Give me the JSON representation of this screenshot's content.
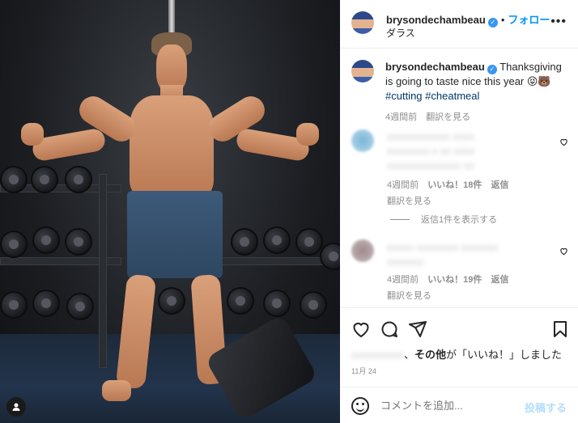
{
  "post": {
    "username": "brysondechambeau",
    "separator": "•",
    "follow_label": "フォロー",
    "more_label": "•••",
    "location": "ダラス"
  },
  "caption": {
    "username": "brysondechambeau",
    "text": "Thanksgiving is going to taste nice this year 😝🐻",
    "hashtag1": "#cutting",
    "hashtag2": "#cheatmeal",
    "time": "4週間前",
    "translate": "翻訳を見る"
  },
  "comments": [
    {
      "blurred_line1": "xxxxxxxxxxxx xxxx",
      "blurred_line2": "xxxxxxxx x xx xxxx",
      "blurred_line3": "xxxxxxxxxxxxxx xx",
      "time": "4週間前",
      "likes": "いいね！18件",
      "reply": "返信",
      "translate": "翻訳を見る"
    },
    {
      "blurred_line1": "xxxxx xxxxxxxx xxxxxxx",
      "blurred_line2": "xxxxxxx",
      "time": "4週間前",
      "likes": "いいね！19件",
      "reply": "返信",
      "translate": "翻訳を見る"
    }
  ],
  "view_replies": "返信1件を表示する",
  "likes_line": {
    "blurred_user": "xxxxxxxxxx",
    "suffix_bold": "その他",
    "suffix_text": "が「いいね！」しました"
  },
  "date": "11月 24",
  "comment_box": {
    "placeholder": "コメントを追加...",
    "post_label": "投稿する"
  },
  "colors": {
    "accent": "#0095f6",
    "verified": "#3897f0",
    "hashtag": "#00376b",
    "muted": "#8e8e8e"
  },
  "icons": [
    "verified-icon",
    "heart-icon",
    "comment-icon",
    "share-icon",
    "bookmark-icon",
    "emoji-icon",
    "user-tag-icon"
  ]
}
